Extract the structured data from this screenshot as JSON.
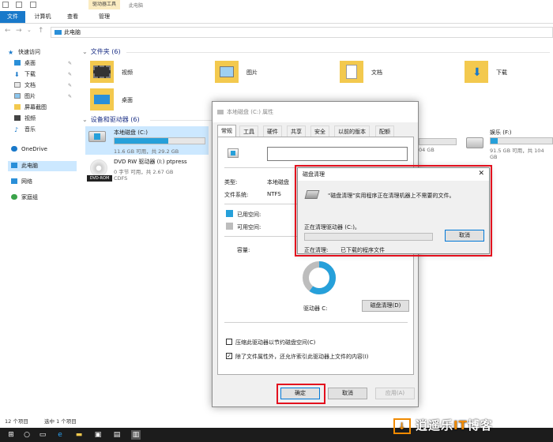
{
  "ribbon": {
    "tabs": [
      "文件",
      "计算机",
      "查看",
      "管理"
    ],
    "context_header": "驱动器工具",
    "window_title": "此电脑"
  },
  "address": {
    "path": "此电脑"
  },
  "sidebar": {
    "quick_access": "快速访问",
    "items": [
      {
        "label": "桌面",
        "icon": "desktop-icon",
        "pinned": true
      },
      {
        "label": "下载",
        "icon": "download-icon",
        "pinned": true
      },
      {
        "label": "文档",
        "icon": "document-icon",
        "pinned": true
      },
      {
        "label": "图片",
        "icon": "picture-icon",
        "pinned": true
      },
      {
        "label": "屏幕截图",
        "icon": "folder-icon",
        "pinned": false
      },
      {
        "label": "视频",
        "icon": "video-icon",
        "pinned": false
      },
      {
        "label": "音乐",
        "icon": "music-icon",
        "pinned": false
      }
    ],
    "onedrive": "OneDrive",
    "this_pc": "此电脑",
    "network": "网络",
    "homegroup": "家庭组"
  },
  "folders_group": "文件夹 (6)",
  "folders": [
    {
      "name": "视频",
      "icon": "video-folder-icon"
    },
    {
      "name": "图片",
      "icon": "picture-folder-icon"
    },
    {
      "name": "文档",
      "icon": "document-folder-icon"
    },
    {
      "name": "下载",
      "icon": "download-folder-icon"
    },
    {
      "name": "桌面",
      "icon": "desktop-folder-icon"
    }
  ],
  "drives_group": "设备和驱动器 (6)",
  "drives": [
    {
      "name": "本地磁盘 (C:)",
      "free": "11.6 GB 可用，共 29.2 GB",
      "used_fraction": 0.6
    },
    {
      "name": "DVD RW 驱动器 (I:) ptpress",
      "free": "0 字节 可用，共 2.67 GB",
      "sub": "CDFS"
    },
    {
      "free_partial": "04 GB"
    },
    {
      "name": "娱乐 (F:)",
      "free": "91.5 GB 可用，共 104 GB",
      "used_fraction": 0.12
    }
  ],
  "status": {
    "count": "12 个项目",
    "selected": "选中 1 个项目"
  },
  "properties": {
    "title": "本地磁盘 (C:) 属性",
    "tabs": [
      "常规",
      "工具",
      "硬件",
      "共享",
      "安全",
      "以前的版本",
      "配额"
    ],
    "type_label": "类型:",
    "type_value": "本地磁盘",
    "fs_label": "文件系统:",
    "fs_value": "NTFS",
    "used_label": "已用空间:",
    "free_label": "可用空间:",
    "capacity_label": "容量:",
    "drive_label": "驱动器 C:",
    "cleanup_button": "磁盘清理(D)",
    "compress_label": "压缩此驱动器以节约磁盘空间(C)",
    "index_label": "除了文件属性外，还允许索引此驱动器上文件的内容(I)",
    "ok": "确定",
    "cancel": "取消",
    "apply": "应用(A)",
    "colors": {
      "used": "#26a0da",
      "free": "#bdbdbd"
    }
  },
  "cleanup": {
    "title": "磁盘清理",
    "message": "\"磁盘清理\"实用程序正在清理机器上不需要的文件。",
    "cleaning_drive": "正在清理驱动器  (C:)。",
    "cancel": "取消",
    "current_label": "正在清理:",
    "current_value": "已下载的程序文件"
  },
  "watermark": {
    "text": "逍遥乐",
    "it": "IT",
    "tail": "博客"
  }
}
